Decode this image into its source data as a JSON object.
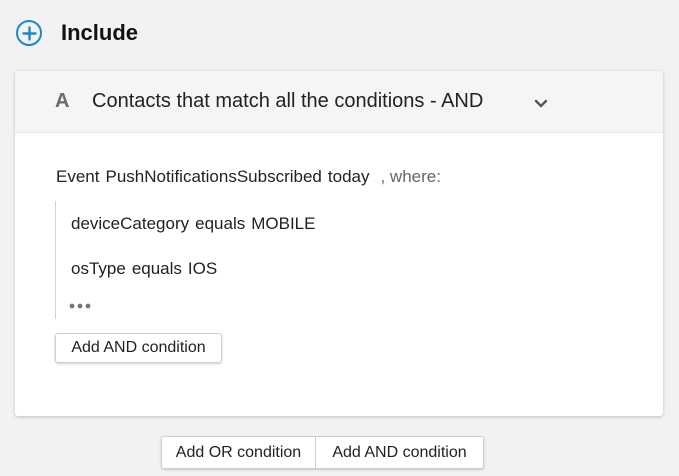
{
  "include": {
    "title": "Include",
    "icon": "plus-circle-icon",
    "accent_color": "#1e88c7"
  },
  "group": {
    "letter": "A",
    "title": "Contacts that match all the conditions - AND",
    "expand_icon": "chevron-down-icon",
    "event": {
      "prefix": "Event",
      "name": "PushNotificationsSubscribed",
      "period": "today",
      "where": ", where:"
    },
    "conditions": [
      {
        "field": "deviceCategory",
        "operator": "equals",
        "value": "MOBILE"
      },
      {
        "field": "osType",
        "operator": "equals",
        "value": "IOS"
      }
    ],
    "more_icon": "more-horizontal-icon",
    "add_and_label": "Add AND condition"
  },
  "footer": {
    "add_or_label": "Add OR condition",
    "add_and_label": "Add AND condition"
  }
}
